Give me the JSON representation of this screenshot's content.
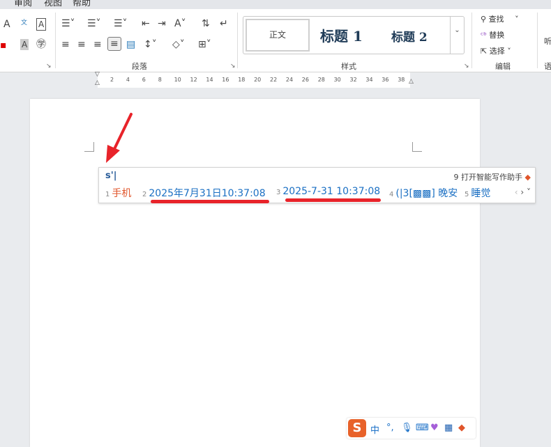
{
  "tabs": [
    "审阅",
    "视图",
    "帮助"
  ],
  "ribbon": {
    "groups": {
      "paragraph": "段落",
      "styles": "样式",
      "editing": "编辑",
      "voice": "语"
    },
    "styles": {
      "normal": "正文",
      "heading1": "标题 1",
      "heading2": "标题 2"
    },
    "editing": {
      "find": "查找",
      "replace": "替换",
      "select": "选择"
    },
    "voice_button": "听"
  },
  "ruler": {
    "ticks": [
      "2",
      "4",
      "6",
      "8",
      "10",
      "12",
      "14",
      "16",
      "18",
      "20",
      "22",
      "24",
      "26",
      "28",
      "30",
      "32",
      "34",
      "36",
      "38"
    ]
  },
  "ime": {
    "input": "s'|",
    "assistant": "9 打开智能写作助手",
    "candidates": [
      {
        "num": "1",
        "text": "手机"
      },
      {
        "num": "2",
        "text": "2025年7月31日10:37:08"
      },
      {
        "num": "3",
        "text": "2025-7-31 10:37:08"
      },
      {
        "num": "4",
        "text": "(|3[▩▩] 晚安"
      },
      {
        "num": "5",
        "text": "睡觉"
      }
    ],
    "highlight_color": "#e8232a"
  },
  "sogou_toolbar": {
    "logo": "S",
    "mode": "中",
    "punct": "°,"
  },
  "colors": {
    "accent": "#1a6fc3",
    "arrow": "#e8232a"
  }
}
